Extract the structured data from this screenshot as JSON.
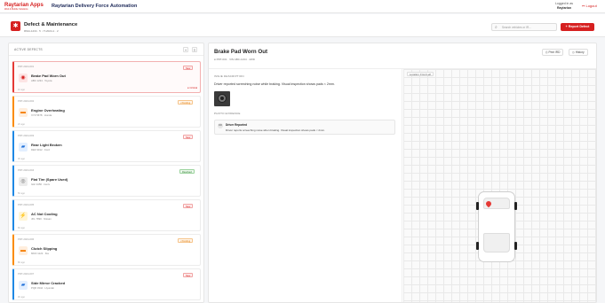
{
  "header": {
    "brand": "Raytarian Apps",
    "brand_tagline": "Web & Mobile Solutions",
    "app_title": "Raytarian Delivery Force Automation",
    "user_label": "Logged in as",
    "user_name": "Raytarian",
    "logout_label": "Logout"
  },
  "page": {
    "title": "Defect & Maintenance",
    "meta": "RMH-1234 · 5 · IT-2024-1 · 2",
    "search_placeholder": "Search vehicles or IR...",
    "report_button": "+ Report Defect"
  },
  "left_panel": {
    "title": "ACTIVE DEFECTS",
    "add_label": "+",
    "filter_label": "≡",
    "cards": [
      {
        "id": "PRT-2024-001",
        "name": "Brake Pad Worn Out",
        "sub": "ABC 1234 · Toyota",
        "foot": "1h ago",
        "status": "New",
        "flag": "● Critical",
        "icon": "brake-icon",
        "glyph": "◉",
        "tone": "red",
        "accent": "red",
        "active": true
      },
      {
        "id": "PRT-2024-002",
        "name": "Engine Overheating",
        "sub": "XYZ 5678 · Honda",
        "foot": "2h ago",
        "status": "• Pending",
        "flag": "",
        "icon": "engine-icon",
        "glyph": "▬",
        "tone": "orange",
        "accent": "orange"
      },
      {
        "id": "PRT-2024-003",
        "name": "Rear Light Broken",
        "sub": "DEF 9012 · Ford",
        "foot": "3h ago",
        "status": "New",
        "flag": "",
        "icon": "car-icon",
        "glyph": "▰",
        "tone": "blue",
        "accent": "blue"
      },
      {
        "id": "PRT-2024-004",
        "name": "Flat Tire (Spare Used)",
        "sub": "GHI 3456 · Isuzu",
        "foot": "5h ago",
        "status": "Resolved",
        "flag": "",
        "icon": "tire-icon",
        "glyph": "◎",
        "tone": "grey",
        "accent": "blue"
      },
      {
        "id": "PRT-2024-005",
        "name": "AC Not Cooling",
        "sub": "JKL 7890 · Nissan",
        "foot": "6h ago",
        "status": "New",
        "flag": "",
        "icon": "lightning-icon",
        "glyph": "⚡",
        "tone": "yellow",
        "accent": "blue"
      },
      {
        "id": "PRT-2024-006",
        "name": "Clutch Slipping",
        "sub": "MNO 1122 · Kia",
        "foot": "8h ago",
        "status": "• Pending",
        "flag": "",
        "icon": "engine-icon",
        "glyph": "▬",
        "tone": "orange",
        "accent": "orange"
      },
      {
        "id": "PRT-2024-007",
        "name": "Side Mirror Cracked",
        "sub": "PQR 3344 · Hyundai",
        "foot": "9h ago",
        "status": "New",
        "flag": "",
        "icon": "car-icon",
        "glyph": "▰",
        "tone": "blue",
        "accent": "blue"
      }
    ]
  },
  "detail": {
    "title": "Brake Pad Worn Out",
    "meta": "● PRT-001 · VIN ABC-1234 · 4WD",
    "print_label": "Print IRD",
    "history_label": "History",
    "issue_label": "ISSUE DESCRIPTION",
    "issue_text": "Driver reported screeching noise while braking. Visual inspection shows pads < 2mm.",
    "updates_label": "PHOTO EVIDENCE",
    "update_author": "Driver Reported",
    "update_initials": "DR",
    "update_text": "Driver reports screeching noise when braking. Visual inspection shows pads < 2mm.",
    "location_label": "Location: Front Left"
  }
}
